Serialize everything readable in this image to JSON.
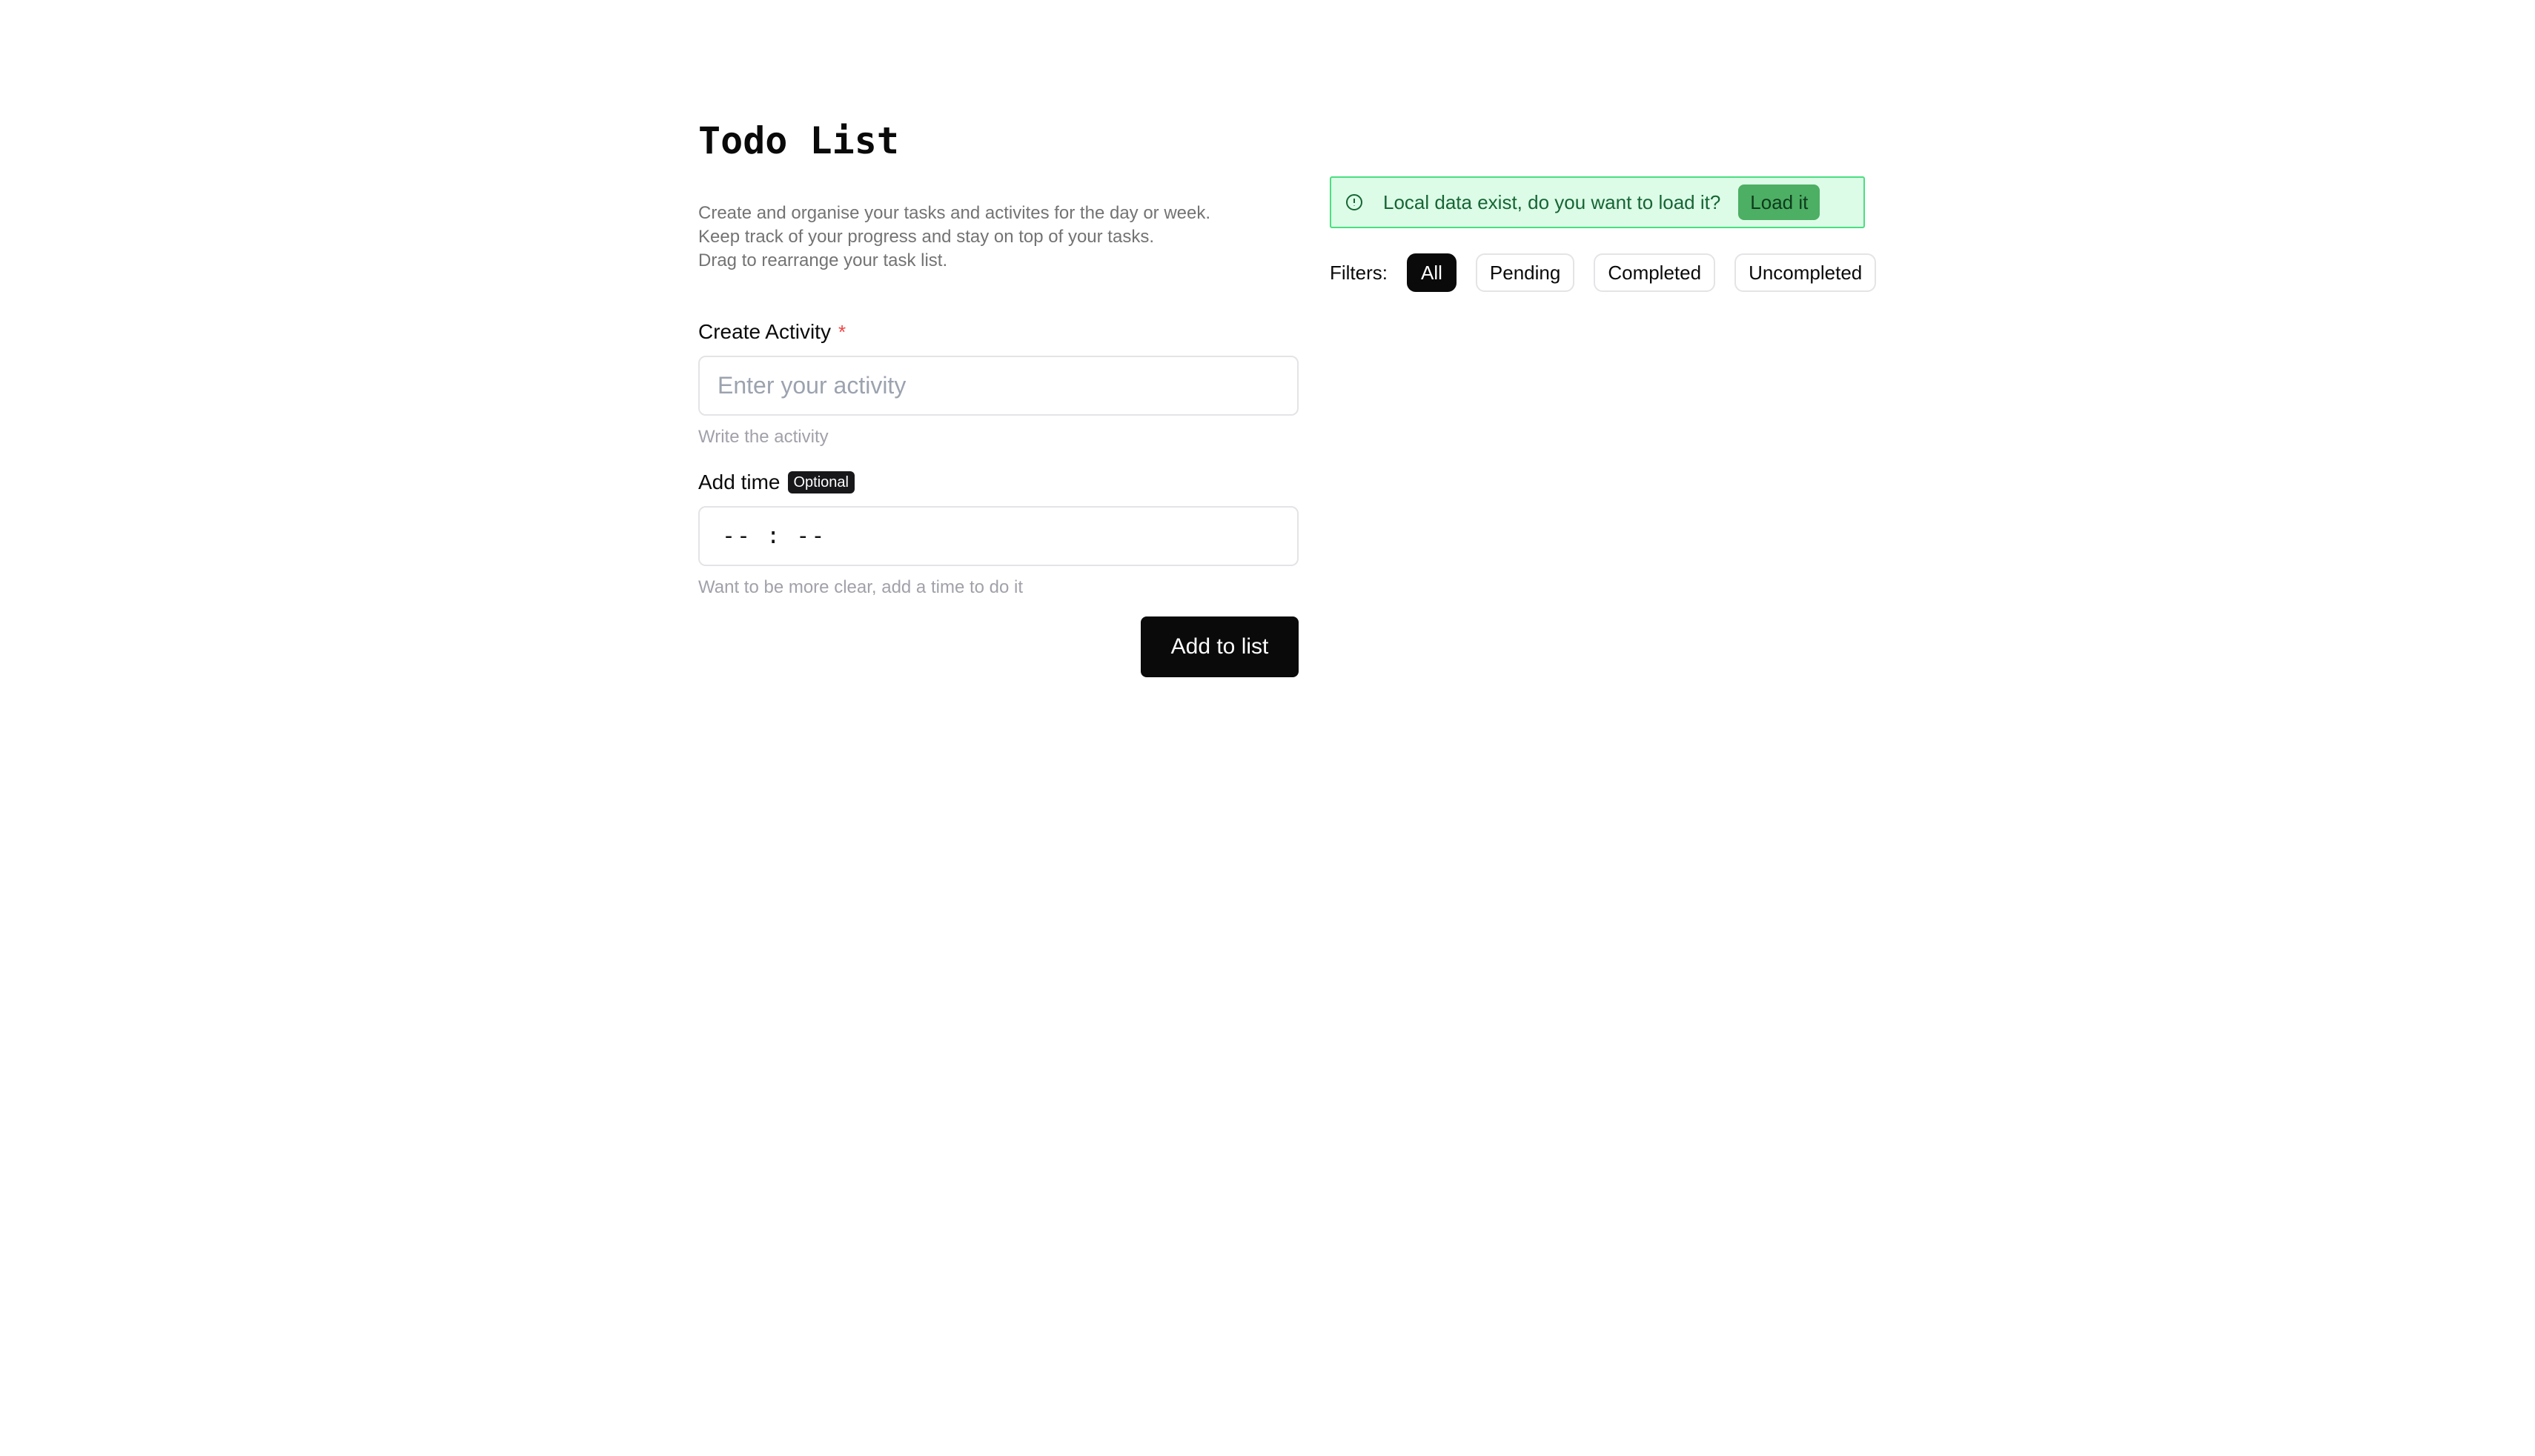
{
  "header": {
    "title": "Todo List",
    "description": [
      "Create and organise your tasks and activites for the day or week.",
      "Keep track of your progress and stay on top of your tasks.",
      "Drag to rearrange your task list."
    ]
  },
  "form": {
    "activity": {
      "label": "Create Activity",
      "required_marker": "*",
      "placeholder": "Enter your activity",
      "value": "",
      "helper": "Write the activity"
    },
    "time": {
      "label": "Add time",
      "badge": "Optional",
      "value": "-- : --",
      "helper": "Want to be more clear, add a time to do it"
    },
    "submit_label": "Add to list"
  },
  "alert": {
    "icon": "info-circle-icon",
    "text": "Local data exist, do you want to load it?",
    "button_label": "Load it",
    "colors": {
      "background": "#dcfce7",
      "border": "#4ade80",
      "button": "#4caf63"
    }
  },
  "filters": {
    "label": "Filters:",
    "options": [
      "All",
      "Pending",
      "Completed",
      "Uncompleted"
    ],
    "selected": "All"
  },
  "colors": {
    "primary": "#0a0a0a",
    "required": "#ef4444",
    "muted_text": "#737373"
  }
}
